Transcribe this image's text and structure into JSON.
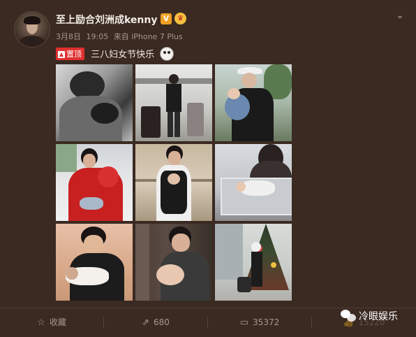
{
  "post": {
    "username": "至上励合刘洲成kenny",
    "verified_badge": "V",
    "vip_badge_icon": "crown-icon",
    "date": "3月8日",
    "time": "19:05",
    "source": "来自 iPhone 7 Plus",
    "pinned_label": "置顶",
    "text": "三八妇女节快乐",
    "emoji_icon": "panda-face-icon",
    "menu_icon": "chevron-down-icon"
  },
  "photos": [
    {
      "name": "photo-1",
      "scene": "black-and-white portrait"
    },
    {
      "name": "photo-2",
      "scene": "airport with luggage"
    },
    {
      "name": "photo-3",
      "scene": "holding baby outdoors"
    },
    {
      "name": "photo-4",
      "scene": "red sweater holding baby"
    },
    {
      "name": "photo-5",
      "scene": "mall with baby carrier"
    },
    {
      "name": "photo-6",
      "scene": "baby in crib"
    },
    {
      "name": "photo-7",
      "scene": "holding newborn"
    },
    {
      "name": "photo-8",
      "scene": "elevator with baby"
    },
    {
      "name": "photo-9",
      "scene": "christmas tree with stroller"
    }
  ],
  "actions": {
    "favorite": {
      "label": "收藏",
      "icon": "star-icon"
    },
    "repost": {
      "label": "680",
      "icon": "repost-icon"
    },
    "comment": {
      "label": "35372",
      "icon": "comment-icon"
    },
    "like": {
      "label": "15220",
      "icon": "thumb-up-icon"
    }
  },
  "watermark": {
    "text": "冷眼娱乐",
    "icon": "wechat-logo-icon"
  },
  "colors": {
    "background": "#3a2a22",
    "pinned_badge": "#e03030",
    "verified_badge": "#f0a020",
    "meta_text": "#a8988a"
  }
}
